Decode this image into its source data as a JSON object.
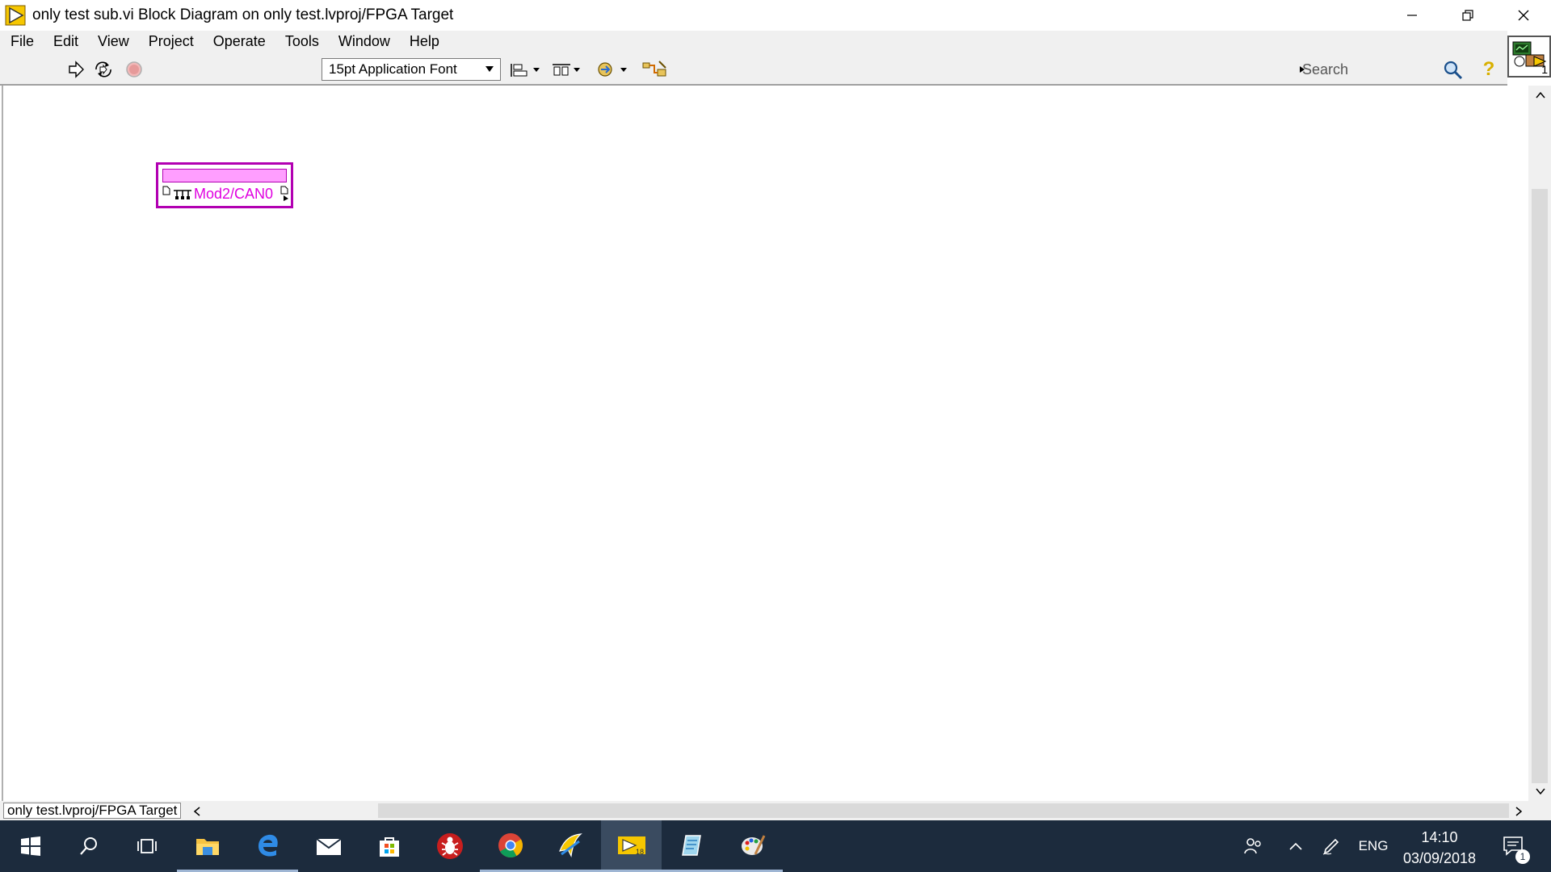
{
  "window": {
    "title": "only test sub.vi Block Diagram on only test.lvproj/FPGA Target"
  },
  "menu": [
    "File",
    "Edit",
    "View",
    "Project",
    "Operate",
    "Tools",
    "Window",
    "Help"
  ],
  "toolbar": {
    "font_select": "15pt Application Font",
    "search_placeholder": "Search",
    "help_label": "?"
  },
  "vi_icon": {
    "badge": "1"
  },
  "diagram": {
    "node_label": "Mod2/CAN0",
    "target_label": "only test.lvproj/FPGA Target"
  },
  "taskbar": {
    "time": "14:10",
    "date": "03/09/2018",
    "language": "ENG",
    "notification_count": "1",
    "labview_version": "18"
  },
  "colors": {
    "node_border": "#b200b2",
    "node_text": "#e000e0",
    "taskbar_bg": "#1c2b3d"
  }
}
